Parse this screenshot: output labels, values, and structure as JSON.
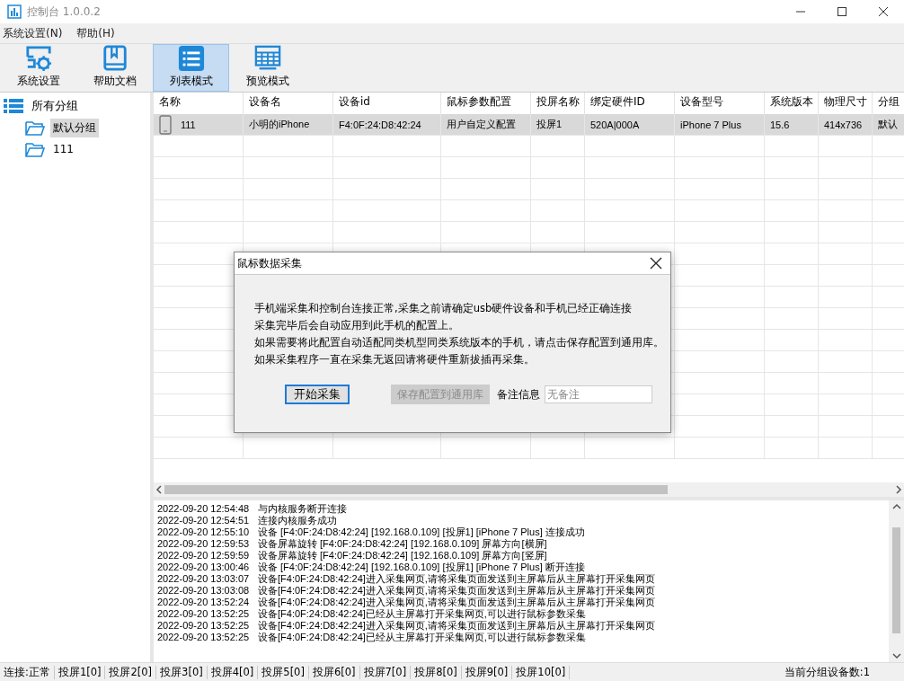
{
  "window": {
    "title": "控制台 1.0.0.2"
  },
  "menu": [
    {
      "label": "系统设置(N)"
    },
    {
      "label": "帮助(H)"
    }
  ],
  "toolbar": [
    {
      "label": "系统设置",
      "kind": "settings",
      "selected": false
    },
    {
      "label": "帮助文档",
      "kind": "book",
      "selected": false
    },
    {
      "label": "列表模式",
      "kind": "list",
      "selected": true
    },
    {
      "label": "预览模式",
      "kind": "grid",
      "selected": false
    }
  ],
  "tree": [
    {
      "label": "所有分组",
      "selected": false,
      "children": [
        {
          "label": "默认分组",
          "selected": true
        },
        {
          "label": "111",
          "selected": false
        }
      ]
    }
  ],
  "table": {
    "columns": [
      "名称",
      "设备名",
      "设备id",
      "鼠标参数配置",
      "投屏名称",
      "绑定硬件ID",
      "设备型号",
      "系统版本",
      "物理尺寸",
      "分组"
    ],
    "rows": [
      {
        "selected": true,
        "cells": [
          "111",
          "小明的iPhone",
          "F4:0F:24:D8:42:24",
          "用户自定义配置",
          "投屏1",
          "520A|000A",
          "iPhone 7 Plus",
          "15.6",
          "414x736",
          "默认"
        ]
      }
    ]
  },
  "log": [
    {
      "time": "2022-09-20 12:54:48",
      "message": "与内核服务断开连接"
    },
    {
      "time": "2022-09-20 12:54:51",
      "message": "连接内核服务成功"
    },
    {
      "time": "2022-09-20 12:55:10",
      "message": "设备 [F4:0F:24:D8:42:24]  [192.168.0.109]  [投屏1]  [iPhone 7 Plus]  连接成功"
    },
    {
      "time": "2022-09-20 12:59:53",
      "message": "设备屏幕旋转 [F4:0F:24:D8:42:24]  [192.168.0.109] 屏幕方向[横屏]"
    },
    {
      "time": "2022-09-20 12:59:59",
      "message": "设备屏幕旋转 [F4:0F:24:D8:42:24]  [192.168.0.109] 屏幕方向[竖屏]"
    },
    {
      "time": "2022-09-20 13:00:46",
      "message": "设备 [F4:0F:24:D8:42:24]  [192.168.0.109]  [投屏1]  [iPhone 7 Plus]  断开连接"
    },
    {
      "time": "2022-09-20 13:03:07",
      "message": "设备[F4:0F:24:D8:42:24]进入采集网页,请将采集页面发送到主屏幕后从主屏幕打开采集网页"
    },
    {
      "time": "2022-09-20 13:03:08",
      "message": "设备[F4:0F:24:D8:42:24]进入采集网页,请将采集页面发送到主屏幕后从主屏幕打开采集网页"
    },
    {
      "time": "2022-09-20 13:52:24",
      "message": "设备[F4:0F:24:D8:42:24]进入采集网页,请将采集页面发送到主屏幕后从主屏幕打开采集网页"
    },
    {
      "time": "2022-09-20 13:52:25",
      "message": "设备[F4:0F:24:D8:42:24]已经从主屏幕打开采集网页,可以进行鼠标参数采集"
    },
    {
      "time": "2022-09-20 13:52:25",
      "message": "设备[F4:0F:24:D8:42:24]进入采集网页,请将采集页面发送到主屏幕后从主屏幕打开采集网页"
    },
    {
      "time": "2022-09-20 13:52:25",
      "message": "设备[F4:0F:24:D8:42:24]已经从主屏幕打开采集网页,可以进行鼠标参数采集"
    }
  ],
  "status_bar": {
    "items": [
      "连接:正常",
      "投屏1[0]",
      "投屏2[0]",
      "投屏3[0]",
      "投屏4[0]",
      "投屏5[0]",
      "投屏6[0]",
      "投屏7[0]",
      "投屏8[0]",
      "投屏9[0]",
      "投屏10[0]"
    ],
    "count": "当前分组设备数:1"
  },
  "dialog": {
    "title": "鼠标数据采集",
    "lines": [
      "手机端采集和控制台连接正常,采集之前请确定usb硬件设备和手机已经正确连接",
      "采集完毕后会自动应用到此手机的配置上。",
      "如果需要将此配置自动适配同类机型同类系统版本的手机，请点击保存配置到通用库。",
      "如果采集程序一直在采集无返回请将硬件重新拔插再采集。"
    ],
    "buttons": [
      {
        "label": "开始采集",
        "disabled": false
      },
      {
        "label": "保存配置到通用库",
        "disabled": true
      }
    ],
    "remark_label": "备注信息",
    "remark_field": {
      "placeholder": "无备注"
    }
  }
}
